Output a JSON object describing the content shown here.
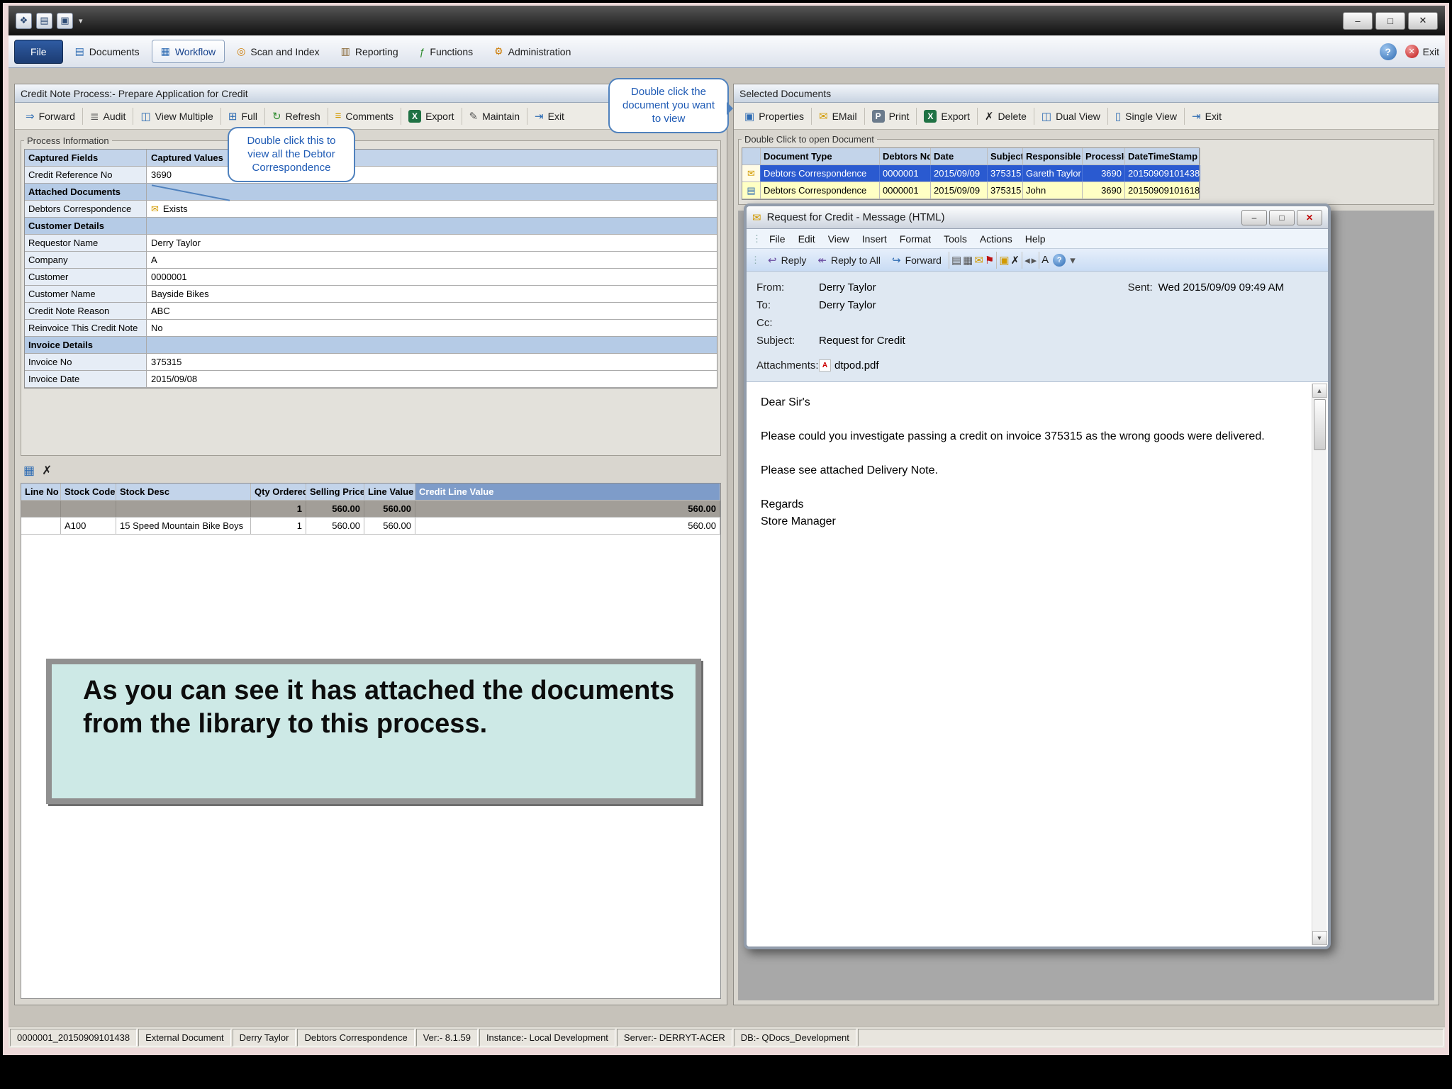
{
  "ribbon": {
    "file": "File",
    "tabs": [
      "Documents",
      "Workflow",
      "Scan and Index",
      "Reporting",
      "Functions",
      "Administration"
    ],
    "active_tab": "Workflow",
    "exit_label": "Exit"
  },
  "left_panel": {
    "title": "Credit Note Process:- Prepare Application for Credit",
    "toolbar": [
      "Forward",
      "Audit",
      "View Multiple",
      "Full",
      "Refresh",
      "Comments",
      "Export",
      "Maintain",
      "Exit"
    ],
    "group_title": "Process Information",
    "grid": {
      "header": [
        "Captured Fields",
        "Captured Values"
      ],
      "rows": [
        {
          "label": "Credit Reference No",
          "value": "3690"
        },
        {
          "label": "Attached Documents",
          "value": ""
        },
        {
          "label": "Debtors Correspondence",
          "value": "Exists"
        },
        {
          "label": "Customer Details",
          "value": ""
        },
        {
          "label": "Requestor Name",
          "value": "Derry Taylor"
        },
        {
          "label": "Company",
          "value": "A"
        },
        {
          "label": "Customer",
          "value": "0000001"
        },
        {
          "label": "Customer Name",
          "value": "Bayside Bikes"
        },
        {
          "label": "Credit Note Reason",
          "value": "ABC"
        },
        {
          "label": "Reinvoice This Credit Note",
          "value": "No"
        },
        {
          "label": "Invoice Details",
          "value": ""
        },
        {
          "label": "Invoice No",
          "value": "375315"
        },
        {
          "label": "Invoice Date",
          "value": "2015/09/08"
        }
      ]
    },
    "callout": "Double click this to view all the Debtor Correspondence",
    "stock_grid": {
      "columns": [
        "Line No",
        "Stock Code",
        "Stock Desc",
        "Qty Ordered",
        "Selling Price",
        "Line Value",
        "Credit Line Value"
      ],
      "summary": {
        "qty": "1",
        "selling_price": "560.00",
        "line_value": "560.00",
        "credit_line_value": "560.00"
      },
      "row": {
        "line_no": "",
        "stock_code": "A100",
        "stock_desc": "15 Speed Mountain Bike Boys",
        "qty": "1",
        "selling_price": "560.00",
        "line_value": "560.00",
        "credit_line_value": "560.00"
      }
    },
    "note": "As you can see it has attached the documents from the library to this process."
  },
  "right_panel": {
    "title": "Selected Documents",
    "toolbar": [
      "Properties",
      "EMail",
      "Print",
      "Export",
      "Delete",
      "Dual View",
      "Single View",
      "Exit"
    ],
    "group_title": "Double Click to open Document",
    "grid": {
      "columns": [
        "Document Type",
        "Debtors No",
        "Date",
        "Subject",
        "Responsible",
        "ProcessId",
        "DateTimeStamp"
      ],
      "rows": [
        {
          "document_type": "Debtors Correspondence",
          "debtors_no": "0000001",
          "date": "2015/09/09",
          "subject": "375315",
          "responsible": "Gareth Taylor",
          "process_id": "3690",
          "date_time_stamp": "20150909101438"
        },
        {
          "document_type": "Debtors Correspondence",
          "debtors_no": "0000001",
          "date": "2015/09/09",
          "subject": "375315",
          "responsible": "John",
          "process_id": "3690",
          "date_time_stamp": "20150909101618"
        }
      ]
    },
    "callout": "Double click the document you want to view"
  },
  "email_window": {
    "title": "Request for Credit - Message (HTML)",
    "menu": [
      "File",
      "Edit",
      "View",
      "Insert",
      "Format",
      "Tools",
      "Actions",
      "Help"
    ],
    "toolbar": [
      "Reply",
      "Reply to All",
      "Forward"
    ],
    "fields": {
      "from_label": "From:",
      "from": "Derry Taylor",
      "sent_label": "Sent:",
      "sent": "Wed 2015/09/09 09:49 AM",
      "to_label": "To:",
      "to": "Derry Taylor",
      "cc_label": "Cc:",
      "cc": "",
      "subject_label": "Subject:",
      "subject": "Request for Credit",
      "attachments_label": "Attachments:",
      "attachment": "dtpod.pdf"
    },
    "body": [
      "Dear Sir's",
      "",
      "Please could you investigate passing a credit on invoice 375315 as the wrong goods were delivered.",
      "",
      "Please see attached Delivery Note.",
      "",
      "Regards",
      "Store Manager"
    ]
  },
  "status_bar": {
    "segments": [
      "0000001_20150909101438",
      "External Document",
      "Derry Taylor",
      "Debtors Correspondence",
      "Ver:- 8.1.59",
      "Instance:- Local Development",
      "Server:- DERRYT-ACER",
      "DB:- QDocs_Development"
    ]
  },
  "icons": {
    "app": "❖",
    "new_doc": "▤",
    "open_folder": "▣",
    "dropdown": "▾",
    "minimize": "–",
    "maximize": "□",
    "close": "✕",
    "help": "?",
    "exit_ribbon": "✕",
    "tab_documents": "▤",
    "tab_workflow": "▦",
    "tab_scan": "◎",
    "tab_reporting": "▥",
    "tab_functions": "ƒ",
    "tab_administration": "⚙",
    "forward": "⇒",
    "audit": "≣",
    "view_multiple": "◫",
    "full": "⊞",
    "refresh": "↻",
    "comments": "≡",
    "export": "X",
    "maintain": "✎",
    "exit": "⇥",
    "properties": "▣",
    "email": "✉",
    "print": "P",
    "delete": "✗",
    "dual_view": "◫",
    "single_view": "▯",
    "exists": "✉",
    "stock_export": "▦",
    "stock_delete": "✗",
    "doc_row_mail": "✉",
    "doc_row_page": "▤",
    "reply": "↩",
    "reply_all": "↞",
    "forward_mail": "↪",
    "print_small": "▤",
    "copy_small": "▦",
    "mail_small": "✉",
    "flag": "⚑",
    "folder_small": "▣",
    "delete_small": "✗",
    "prev": "◂",
    "next": "▸",
    "font_btn": "A",
    "mini_help": "?",
    "pdf": "A",
    "scroll_up": "▲",
    "scroll_down": "▼"
  },
  "colors": {
    "selected_row": "#2a5ad0",
    "row_highlight": "#ffffc4",
    "note_bg": "#cde9e6",
    "callout_border": "#4f81bd",
    "ribbon_file_bg": "#1c3c72",
    "grid_header": "#c3d4ea"
  }
}
